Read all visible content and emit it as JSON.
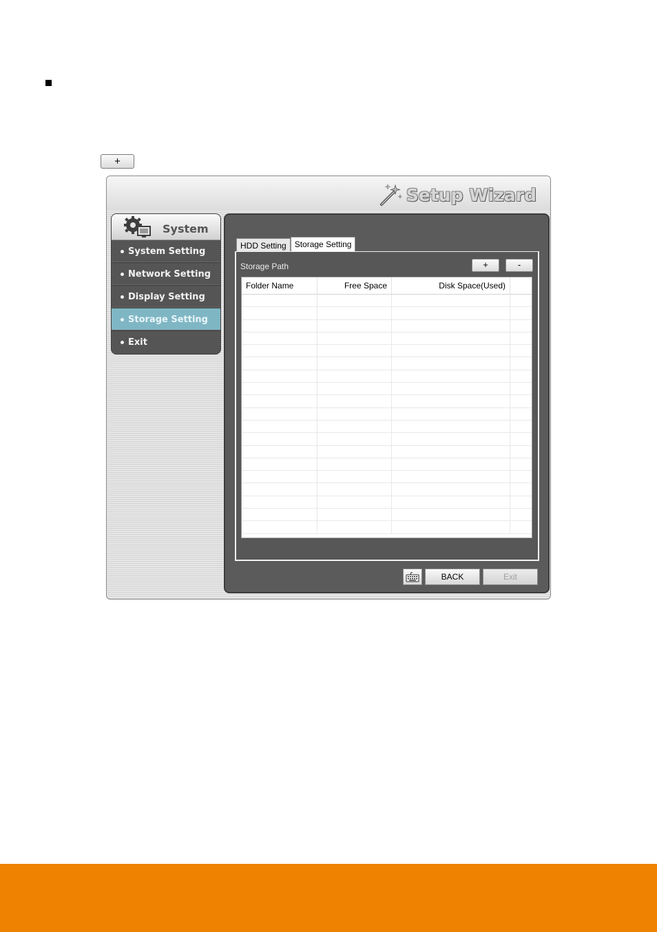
{
  "page": {
    "inline_button_label": "+",
    "footer_color": "#ef8200"
  },
  "wizard": {
    "title": "Setup Wizard",
    "title_icon": "magic-wand-icon"
  },
  "sidebar": {
    "header_icon": "gear-monitor-icon",
    "title": "System",
    "items": [
      {
        "label": "System Setting",
        "active": false
      },
      {
        "label": "Network Setting",
        "active": false
      },
      {
        "label": "Display Setting",
        "active": false
      },
      {
        "label": "Storage Setting",
        "active": true
      },
      {
        "label": "Exit",
        "active": false
      }
    ],
    "active_color": "#7fb6c4"
  },
  "tabs": [
    {
      "label": "HDD Setting",
      "selected": false
    },
    {
      "label": "Storage Setting",
      "selected": true
    }
  ],
  "storage": {
    "path_label": "Storage Path",
    "add_label": "+",
    "remove_label": "-",
    "columns": [
      "Folder Name",
      "Free Space",
      "Disk Space(Used)"
    ],
    "rows": []
  },
  "footer_buttons": {
    "keyboard_icon": "keyboard-icon",
    "back_label": "BACK",
    "exit_label": "Exit",
    "exit_enabled": false
  }
}
